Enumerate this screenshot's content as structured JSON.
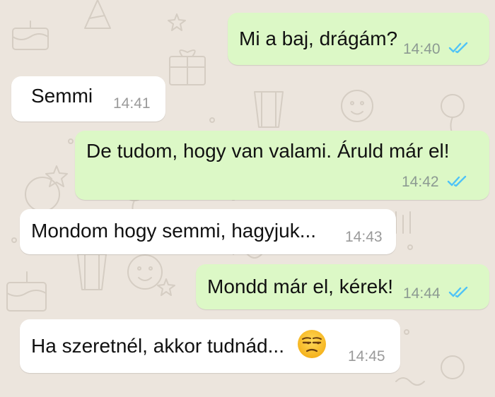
{
  "chat": {
    "background_color": "#ece5dd",
    "outgoing_color": "#dcf8c6",
    "incoming_color": "#ffffff",
    "tick_color": "#4fc3f7",
    "messages": [
      {
        "direction": "outgoing",
        "text": "Mi a baj, drágám?",
        "time": "14:40",
        "status": "read-double-tick-icon"
      },
      {
        "direction": "incoming",
        "text": "Semmi",
        "time": "14:41"
      },
      {
        "direction": "outgoing",
        "text": "De tudom, hogy van valami. Áruld már el!",
        "time": "14:42",
        "status": "read-double-tick-icon"
      },
      {
        "direction": "incoming",
        "text": "Mondom hogy semmi, hagyjuk...",
        "time": "14:43"
      },
      {
        "direction": "outgoing",
        "text": "Mondd már el, kérek!",
        "time": "14:44",
        "status": "read-double-tick-icon"
      },
      {
        "direction": "incoming",
        "text": "Ha szeretnél, akkor tudnád...",
        "time": "14:45",
        "emoji": "unamused-face-emoji"
      }
    ]
  }
}
